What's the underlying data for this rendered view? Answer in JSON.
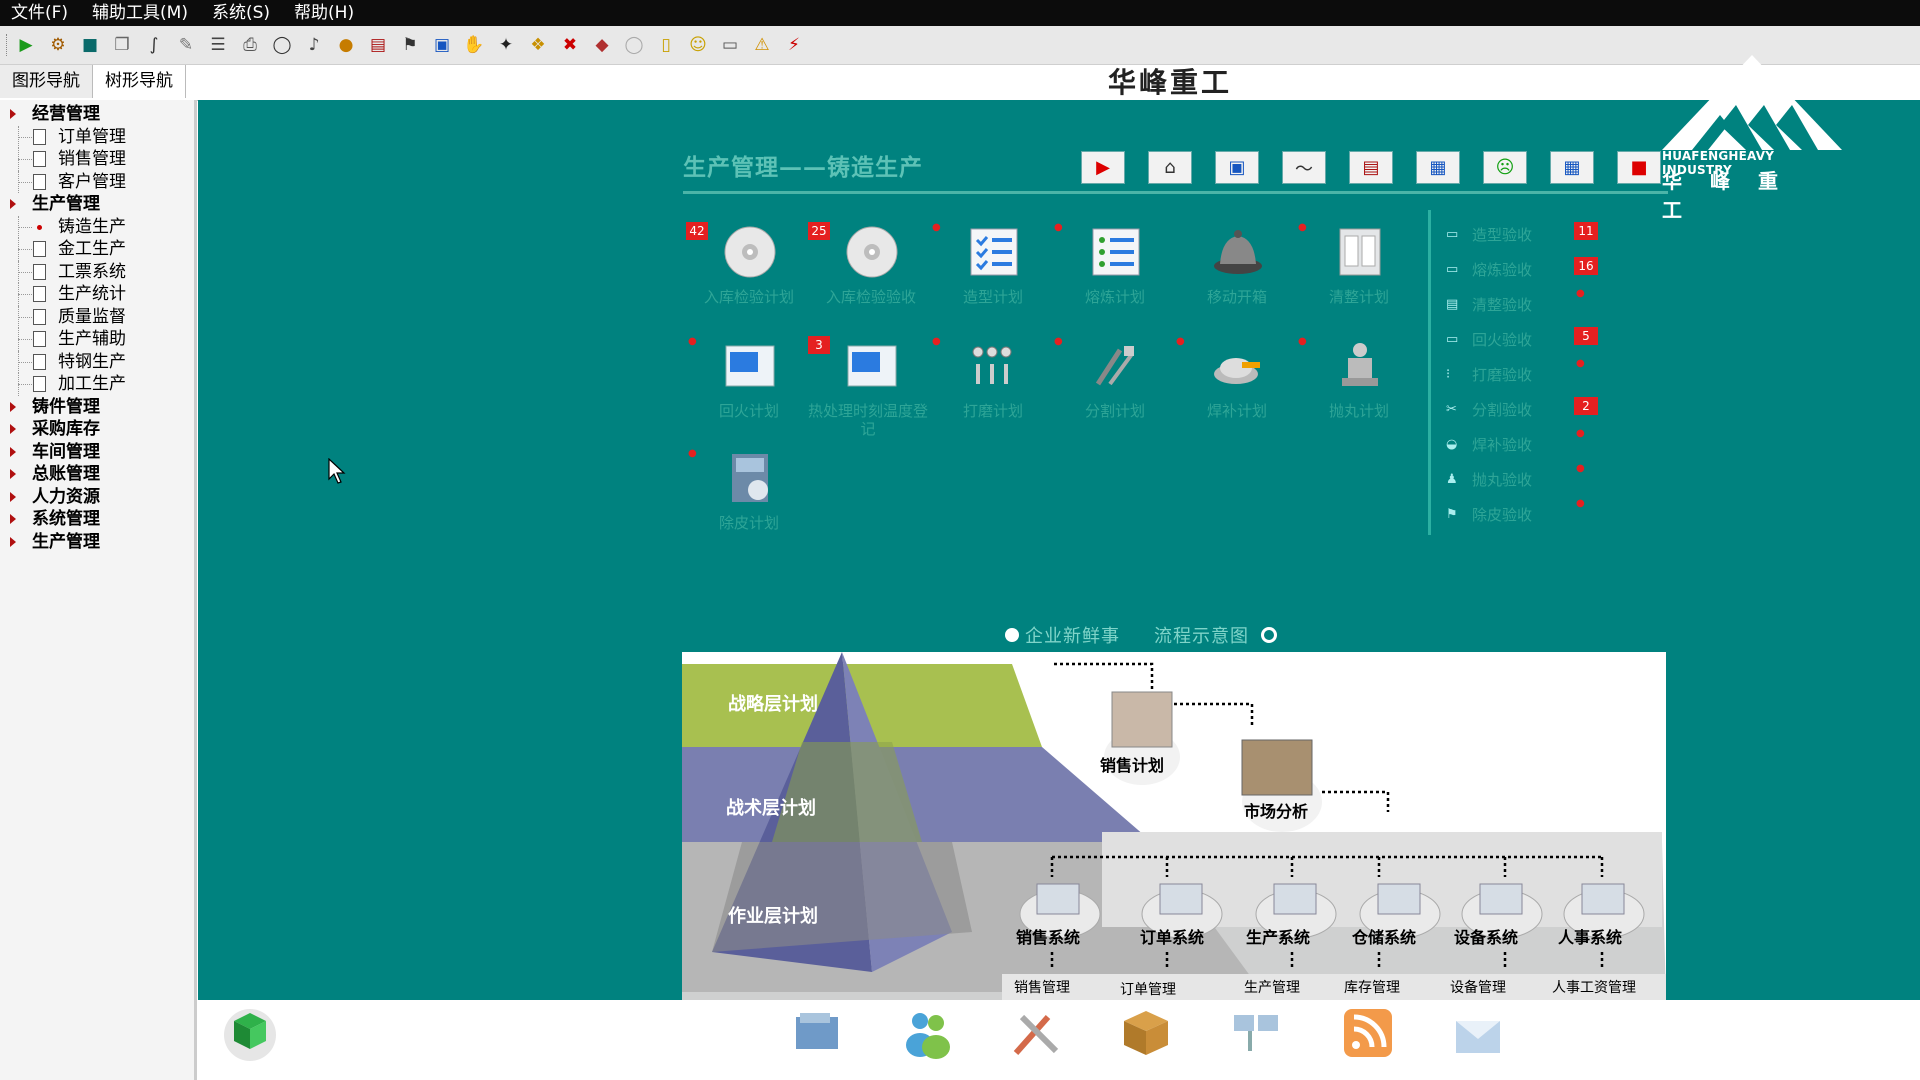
{
  "menubar": {
    "items": [
      "文件(F)",
      "辅助工具(M)",
      "系统(S)",
      "帮助(H)"
    ]
  },
  "toolbar": {
    "icons": [
      "play-icon",
      "connect-icon",
      "save-icon",
      "copy-icon",
      "formula-icon",
      "edit-icon",
      "list-icon",
      "print-icon",
      "chat-icon",
      "speaker-icon",
      "fire-icon",
      "report-icon",
      "flag-icon",
      "module-icon",
      "hand-icon",
      "run-icon",
      "close-x-icon",
      "gear-icon",
      "book-icon",
      "bubble-icon",
      "note-icon",
      "smiley-icon",
      "truck-icon",
      "warning-icon",
      "bolt-icon"
    ]
  },
  "nav_tabs": [
    "图形导航",
    "树形导航"
  ],
  "system_title": "华峰重工",
  "tree": [
    {
      "label": "经营管理",
      "children": [
        "订单管理",
        "销售管理",
        "客户管理"
      ]
    },
    {
      "label": "生产管理",
      "children": [
        "铸造生产",
        "金工生产",
        "工票系统",
        "生产统计",
        "质量监督",
        "生产辅助",
        "特钢生产",
        "加工生产"
      ]
    },
    {
      "label": "铸件管理",
      "children": []
    },
    {
      "label": "采购库存",
      "children": []
    },
    {
      "label": "车间管理",
      "children": []
    },
    {
      "label": "总账管理",
      "children": []
    },
    {
      "label": "人力资源",
      "children": []
    },
    {
      "label": "系统管理",
      "children": []
    },
    {
      "label": "生产管理",
      "children": []
    }
  ],
  "logo": {
    "english": "HUAFENGHEAVY INDUSTRY",
    "chinese": "华峰重工"
  },
  "section_title": "生产管理——铸造生产",
  "modules": [
    {
      "label": "入库检验计划",
      "badge": "42"
    },
    {
      "label": "入库检验验收",
      "badge": "25"
    },
    {
      "label": "造型计划",
      "badge": ""
    },
    {
      "label": "熔炼计划",
      "badge": ""
    },
    {
      "label": "移动开箱",
      "badge": ""
    },
    {
      "label": "清整计划",
      "badge": ""
    },
    {
      "label": "回火计划",
      "badge": ""
    },
    {
      "label": "热处理时刻温度登记",
      "badge": "3"
    },
    {
      "label": "打磨计划",
      "badge": ""
    },
    {
      "label": "分割计划",
      "badge": ""
    },
    {
      "label": "焊补计划",
      "badge": ""
    },
    {
      "label": "抛丸计划",
      "badge": ""
    },
    {
      "label": "除皮计划",
      "badge": ""
    }
  ],
  "acceptance": [
    {
      "label": "造型验收",
      "badge": "11"
    },
    {
      "label": "熔炼验收",
      "badge": "16"
    },
    {
      "label": "清整验收",
      "badge": ""
    },
    {
      "label": "回火验收",
      "badge": "5"
    },
    {
      "label": "打磨验收",
      "badge": ""
    },
    {
      "label": "分割验收",
      "badge": "2"
    },
    {
      "label": "焊补验收",
      "badge": ""
    },
    {
      "label": "抛丸验收",
      "badge": ""
    },
    {
      "label": "除皮验收",
      "badge": ""
    }
  ],
  "carousel": {
    "tab1": "企业新鲜事",
    "tab2": "流程示意图"
  },
  "diagram": {
    "layers": [
      "战略层计划",
      "战术层计划",
      "作业层计划"
    ],
    "top_nodes": [
      "销售计划",
      "市场分析"
    ],
    "systems": [
      "销售系统",
      "订单系统",
      "生产系统",
      "仓储系统",
      "设备系统",
      "人事系统"
    ],
    "bottom_labels": [
      "销售管理",
      "订单管理",
      "生产管理",
      "库存管理",
      "设备管理",
      "人事工资管理"
    ]
  },
  "bottom_icons": [
    "cube-icon",
    "folder-icon",
    "users-icon",
    "tools-icon",
    "box-icon",
    "network-icon",
    "rss-icon",
    "mail-icon"
  ],
  "colors": {
    "main_bg": "#00827f",
    "label": "#2ea597",
    "badge": "#e52020"
  }
}
